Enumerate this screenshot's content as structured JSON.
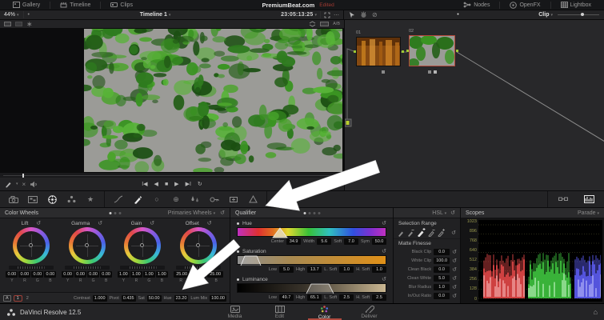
{
  "icons": {
    "chevron": "▾",
    "reset": "↺",
    "ellipsis": "⋯",
    "dot": "•",
    "close": "×",
    "home": "⌂",
    "skip_back": "I◀",
    "step_back": "◀",
    "stop": "■",
    "play": "▶",
    "skip_fwd": "▶I",
    "loop": "↻",
    "star": "★",
    "window": "○",
    "target": "⊕",
    "slash": "⊘",
    "wand": "∗",
    "ab": "A/B"
  },
  "top_bar": {
    "gallery": "Gallery",
    "timeline": "Timeline",
    "clips": "Clips",
    "project_title": "PremiumBeat.com",
    "edited_badge": "Edited",
    "nodes": "Nodes",
    "openfx": "OpenFX",
    "lightbox": "Lightbox"
  },
  "viewer": {
    "zoom_level": "44%",
    "timeline_name": "Timeline 1",
    "timecode": "23:05:13:25"
  },
  "node_graph": {
    "clip_label": "Clip",
    "nodes": [
      {
        "id": "01"
      },
      {
        "id": "02"
      }
    ]
  },
  "color_wheels": {
    "title": "Color Wheels",
    "mode": "Primaries Wheels",
    "wheels": [
      {
        "name": "Lift",
        "values": [
          "0.00",
          "0.00",
          "0.00",
          "0.00"
        ],
        "channels": [
          "Y",
          "R",
          "G",
          "B"
        ]
      },
      {
        "name": "Gamma",
        "values": [
          "0.00",
          "0.00",
          "0.00",
          "0.00"
        ],
        "channels": [
          "Y",
          "R",
          "G",
          "B"
        ]
      },
      {
        "name": "Gain",
        "values": [
          "1.00",
          "1.00",
          "1.00",
          "1.00"
        ],
        "channels": [
          "Y",
          "R",
          "G",
          "B"
        ]
      },
      {
        "name": "Offset",
        "values": [
          "25.00",
          "25.00",
          "25.00"
        ],
        "channels": [
          "R",
          "G",
          "B"
        ]
      }
    ],
    "adjust": {
      "auto": "A",
      "page1": "1",
      "page2": "2",
      "contrast_label": "Contrast",
      "contrast": "1.000",
      "pivot_label": "Pivot",
      "pivot": "0.435",
      "sat_label": "Sat",
      "sat": "50.00",
      "hue_label": "Hue",
      "hue": "23.20",
      "lum_label": "Lum Mix",
      "lum": "100.00"
    }
  },
  "qualifier": {
    "title": "Qualifier",
    "hue": {
      "name": "Hue",
      "center_label": "Center",
      "center": "34.9",
      "width_label": "Width",
      "width": "5.6",
      "soft_label": "Soft",
      "soft": "7.0",
      "sym_label": "Sym",
      "sym": "50.0"
    },
    "saturation": {
      "name": "Saturation",
      "low_label": "Low",
      "low": "5.0",
      "high_label": "High",
      "high": "13.7",
      "lsoft_label": "L. Soft",
      "lsoft": "1.0",
      "hsoft_label": "H. Soft",
      "hsoft": "1.0"
    },
    "luminance": {
      "name": "Luminance",
      "low_label": "Low",
      "low": "49.7",
      "high_label": "High",
      "high": "65.1",
      "lsoft_label": "L. Soft",
      "lsoft": "2.5",
      "hsoft_label": "H. Soft",
      "hsoft": "2.5"
    }
  },
  "selection": {
    "hsl_mode": "HSL",
    "title": "Selection Range",
    "matte_title": "Matte Finesse",
    "rows": [
      {
        "label": "Black Clip",
        "value": "0.0"
      },
      {
        "label": "White Clip",
        "value": "100.0"
      },
      {
        "label": "Clean Black",
        "value": "0.0"
      },
      {
        "label": "Clean White",
        "value": "5.0"
      },
      {
        "label": "Blur Radius",
        "value": "1.0"
      },
      {
        "label": "In/Out Ratio",
        "value": "0.0"
      }
    ]
  },
  "scopes": {
    "title": "Scopes",
    "mode": "Parade",
    "ticks": [
      "1023",
      "896",
      "768",
      "640",
      "512",
      "384",
      "256",
      "128",
      "0"
    ]
  },
  "bottom_bar": {
    "app_title": "DaVinci Resolve 12.5",
    "tabs": [
      {
        "label": "Media"
      },
      {
        "label": "Edit"
      },
      {
        "label": "Color"
      },
      {
        "label": "Deliver"
      }
    ]
  }
}
